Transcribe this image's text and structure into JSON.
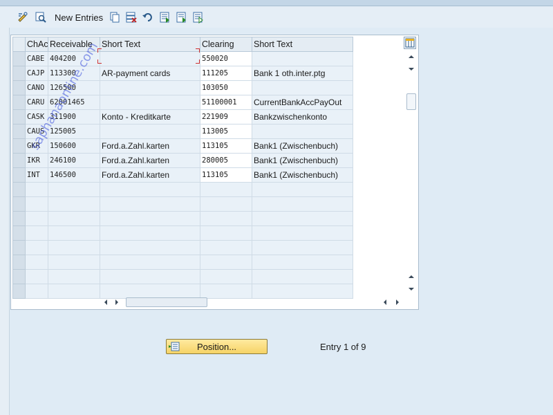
{
  "toolbar": {
    "new_entries_label": "New Entries",
    "icons": [
      "display-change-icon",
      "details-icon",
      "copy-icon",
      "delete-icon",
      "undo-icon",
      "select-all-icon",
      "select-block-icon",
      "deselect-all-icon"
    ]
  },
  "table": {
    "headers": [
      "ChAc",
      "Receivable",
      "Short Text",
      "Clearing",
      "Short Text"
    ],
    "rows": [
      {
        "chac": "CABE",
        "receivable": "404200",
        "short_text": "",
        "clearing": "550020",
        "short_text2": ""
      },
      {
        "chac": "CAJP",
        "receivable": "113300",
        "short_text": "AR-payment cards",
        "clearing": "111205",
        "short_text2": "Bank 1 oth.inter.ptg"
      },
      {
        "chac": "CANO",
        "receivable": "126500",
        "short_text": "",
        "clearing": "103050",
        "short_text2": ""
      },
      {
        "chac": "CARU",
        "receivable": "62001465",
        "short_text": "",
        "clearing": "51100001",
        "short_text2": "CurrentBankAccPayOut"
      },
      {
        "chac": "CASK",
        "receivable": "311900",
        "short_text": "Konto - Kreditkarte",
        "clearing": "221909",
        "short_text2": "Bankzwischenkonto"
      },
      {
        "chac": "CAUS",
        "receivable": "125005",
        "short_text": "",
        "clearing": "113005",
        "short_text2": ""
      },
      {
        "chac": "GKR",
        "receivable": "150600",
        "short_text": "Ford.a.Zahl.karten",
        "clearing": "113105",
        "short_text2": "Bank1 (Zwischenbuch)"
      },
      {
        "chac": "IKR",
        "receivable": "246100",
        "short_text": "Ford.a.Zahl.karten",
        "clearing": "280005",
        "short_text2": "Bank1 (Zwischenbuch)"
      },
      {
        "chac": "INT",
        "receivable": "146500",
        "short_text": "Ford.a.Zahl.karten",
        "clearing": "113105",
        "short_text2": "Bank1 (Zwischenbuch)"
      }
    ],
    "empty_rows": 8
  },
  "footer": {
    "position_label": "Position...",
    "entry_text": "Entry 1 of 9"
  },
  "watermark": "saphanaonline.com",
  "colors": {
    "accent_button": "#f6d366",
    "background": "#dfebf5",
    "header_bg": "#e4ecf3"
  }
}
